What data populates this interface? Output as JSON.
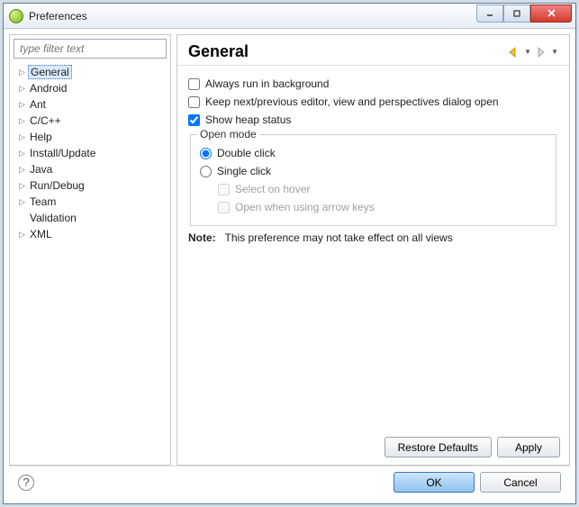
{
  "window": {
    "title": "Preferences"
  },
  "filter": {
    "placeholder": "type filter text"
  },
  "tree": {
    "items": [
      {
        "label": "General",
        "expandable": true,
        "selected": true
      },
      {
        "label": "Android",
        "expandable": true
      },
      {
        "label": "Ant",
        "expandable": true
      },
      {
        "label": "C/C++",
        "expandable": true
      },
      {
        "label": "Help",
        "expandable": true
      },
      {
        "label": "Install/Update",
        "expandable": true
      },
      {
        "label": "Java",
        "expandable": true
      },
      {
        "label": "Run/Debug",
        "expandable": true
      },
      {
        "label": "Team",
        "expandable": true
      },
      {
        "label": "Validation",
        "expandable": false
      },
      {
        "label": "XML",
        "expandable": true
      }
    ]
  },
  "page": {
    "heading": "General",
    "check1": "Always run in background",
    "check2": "Keep next/previous editor, view and perspectives dialog open",
    "check3": "Show heap status",
    "openmode_legend": "Open mode",
    "radio1": "Double click",
    "radio2": "Single click",
    "sub1": "Select on hover",
    "sub2": "Open when using arrow keys",
    "note_label": "Note:",
    "note_text": "This preference may not take effect on all views"
  },
  "buttons": {
    "restore": "Restore Defaults",
    "apply": "Apply",
    "ok": "OK",
    "cancel": "Cancel"
  }
}
